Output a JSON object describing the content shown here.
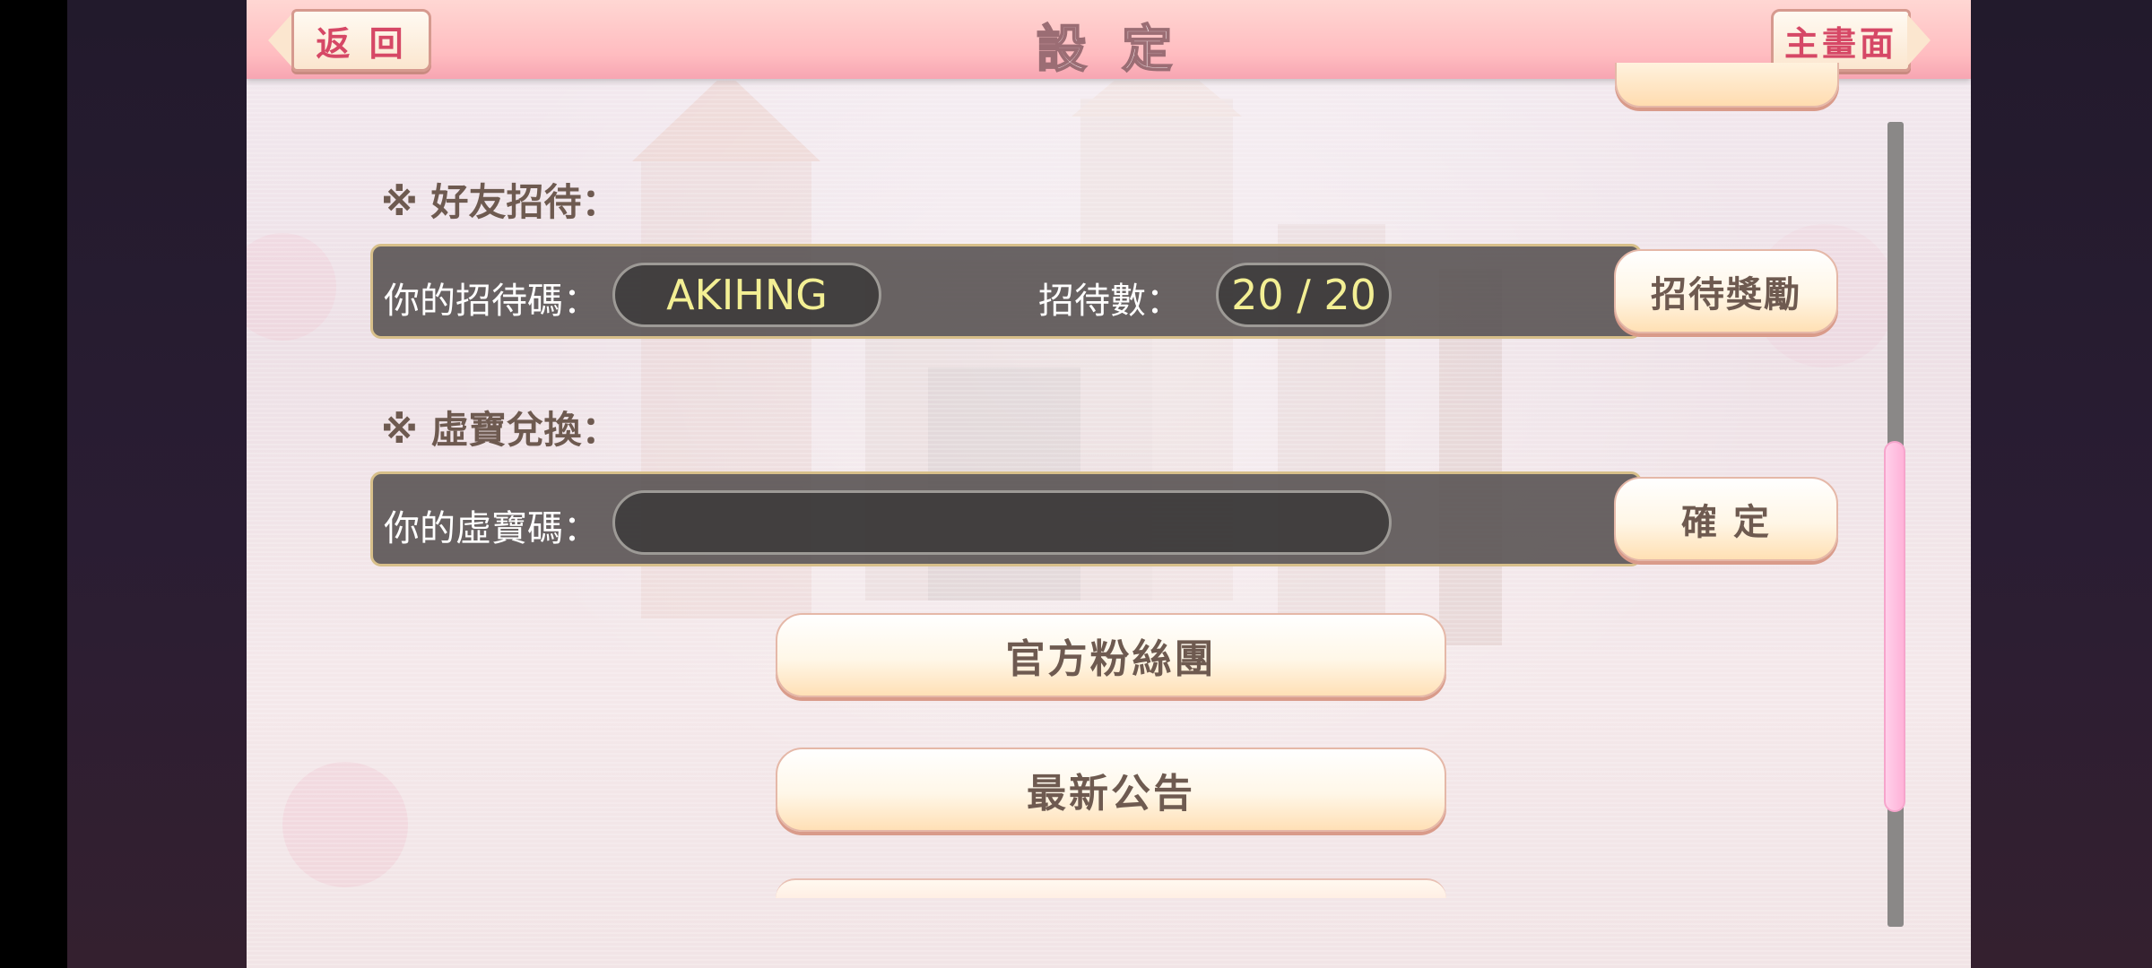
{
  "header": {
    "title": "設 定",
    "back_label": "返 回",
    "home_label": "主畫面"
  },
  "friend_invite": {
    "heading": "※ 好友招待：",
    "code_label": "你的招待碼：",
    "code_value": "AKIHNG",
    "count_label": "招待數：",
    "count_value": "20 / 20",
    "reward_button": "招待獎勵"
  },
  "redeem": {
    "heading": "※ 虛寶兌換：",
    "code_label": "你的虛寶碼：",
    "code_value": "",
    "confirm_button": "確 定"
  },
  "buttons": {
    "fan_page": "官方粉絲團",
    "news": "最新公告"
  },
  "scrollbar": {
    "position_fraction": 0.6
  },
  "colors": {
    "header_pink": "#ffbcc0",
    "accent_red": "#d64866",
    "code_yellow": "#f3ef94",
    "panel_gray": "#555050",
    "button_cream": "#ffe0b4"
  }
}
